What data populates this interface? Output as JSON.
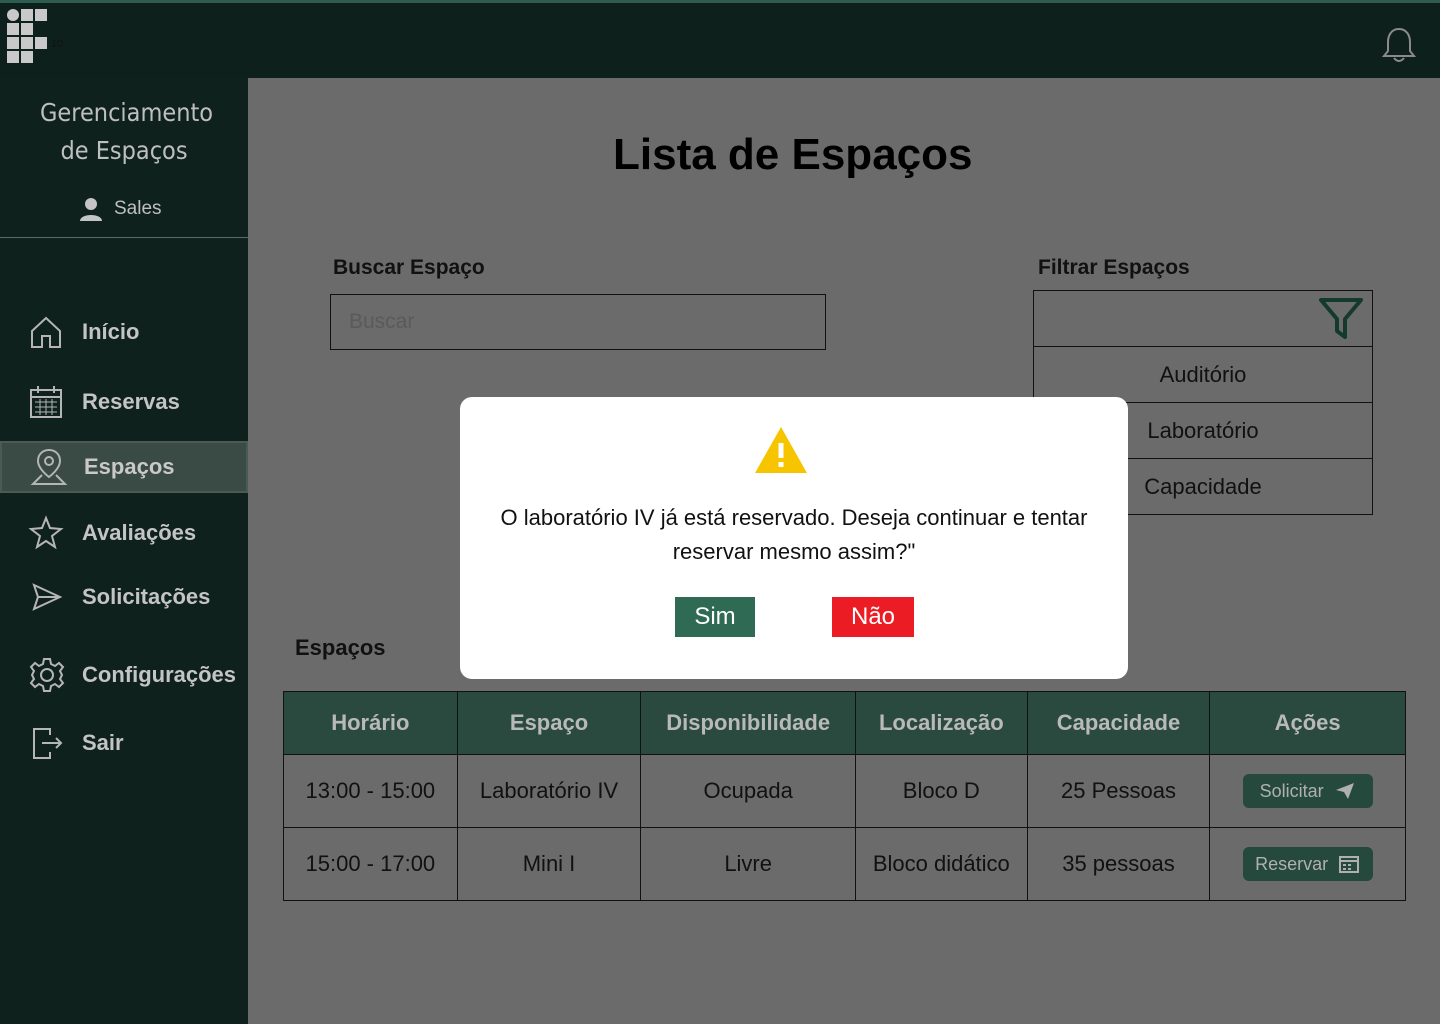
{
  "app": {
    "logo_number": "10",
    "title": "Gerenciamento de Espaços",
    "user": "Sales"
  },
  "sidebar": {
    "items": [
      {
        "label": "Início",
        "icon": "home-icon"
      },
      {
        "label": "Reservas",
        "icon": "calendar-icon"
      },
      {
        "label": "Espaços",
        "icon": "location-pin-icon",
        "active": true
      },
      {
        "label": "Avaliações",
        "icon": "star-icon"
      },
      {
        "label": "Solicitações",
        "icon": "send-icon"
      },
      {
        "label": "Configurações",
        "icon": "gear-icon"
      },
      {
        "label": "Sair",
        "icon": "logout-icon"
      }
    ]
  },
  "main": {
    "title": "Lista de Espaços",
    "search_label": "Buscar Espaço",
    "search_placeholder": "Buscar",
    "filter_label": "Filtrar Espaços",
    "filter_options": [
      "Auditório",
      "Laboratório",
      "Capacidade"
    ],
    "section_label": "Espaços"
  },
  "table": {
    "headers": [
      "Horário",
      "Espaço",
      "Disponibilidade",
      "Localização",
      "Capacidade",
      "Ações"
    ],
    "rows": [
      {
        "horario": "13:00 - 15:00",
        "espaco": "Laboratório IV",
        "disponibilidade": "Ocupada",
        "localizacao": "Bloco D",
        "capacidade": "25 Pessoas",
        "acao": "Solicitar"
      },
      {
        "horario": "15:00 - 17:00",
        "espaco": "Mini I",
        "disponibilidade": "Livre",
        "localizacao": "Bloco didático",
        "capacidade": "35 pessoas",
        "acao": "Reservar"
      }
    ]
  },
  "modal": {
    "message": "O laboratório IV já está reservado. Deseja continuar e tentar reservar mesmo assim?\"",
    "yes": "Sim",
    "no": "Não"
  },
  "colors": {
    "sidebar_bg": "#0e211d",
    "table_header": "#2a4a3f",
    "btn_yes": "#2f6a55",
    "btn_no": "#ec1c24",
    "warning": "#f7c400"
  }
}
